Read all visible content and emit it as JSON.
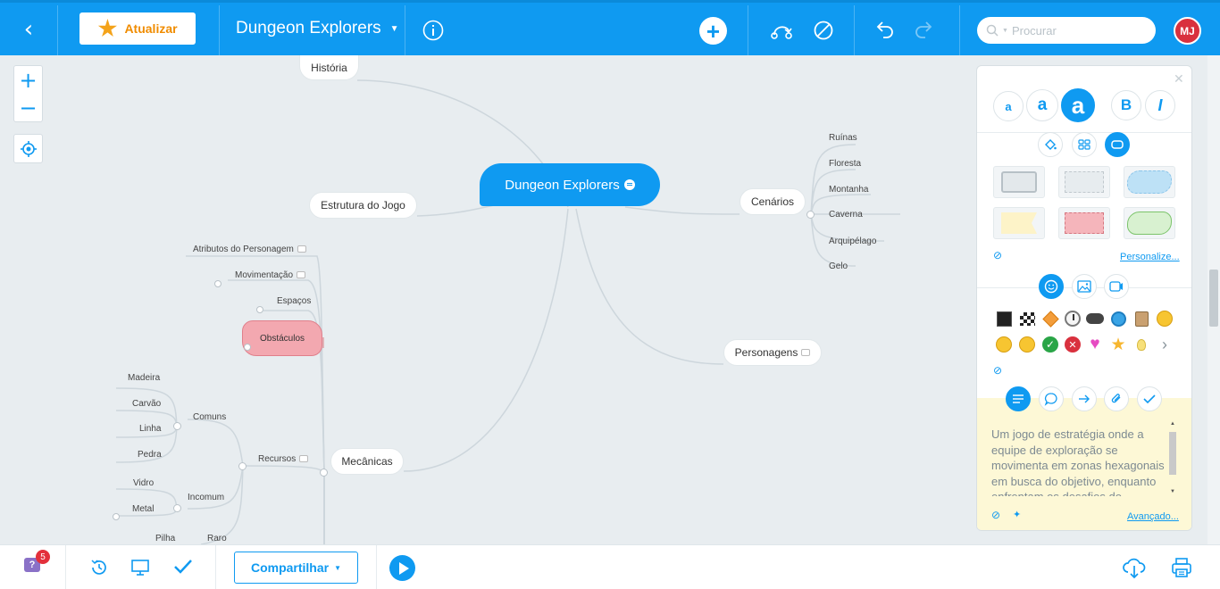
{
  "app": {
    "update_label": "Atualizar",
    "map_title": "Dungeon Explorers",
    "search_placeholder": "Procurar",
    "user_initials": "MJ",
    "notification_count": "5"
  },
  "mindmap": {
    "central": "Dungeon Explorers",
    "main_topics": [
      "História",
      "Estrutura do Jogo",
      "Cenários",
      "Personagens",
      "Mecânicas"
    ],
    "cenarios_children": [
      "Ruínas",
      "Floresta",
      "Montanha",
      "Caverna",
      "Arquipélago",
      "Gelo"
    ],
    "mecanicas_children": [
      "Atributos do Personagem",
      "Movimentação",
      "Espaços",
      "Obstáculos",
      "Recursos"
    ],
    "recursos_children": [
      "Comuns",
      "Incomum",
      "Raro"
    ],
    "comuns_children": [
      "Madeira",
      "Carvão",
      "Linha",
      "Pedra"
    ],
    "incomum_children": [
      "Vidro",
      "Metal"
    ],
    "raro_children": [
      "Pilha"
    ]
  },
  "panel": {
    "font_sizes": [
      "a",
      "a",
      "a"
    ],
    "bold": "B",
    "italic": "I",
    "customize_link": "Personalize...",
    "advanced_link": "Avançado...",
    "note_text": "Um jogo de estratégia onde a equipe de exploração se movimenta em zonas hexagonais em busca do objetivo, enquanto enfrentam os desafios do",
    "icons": [
      "black-square-icon",
      "checkered-flag-icon",
      "diamond-icon",
      "clock-icon",
      "gamepad-icon",
      "blue-clock-icon",
      "address-book-icon",
      "smiley-icon",
      "neutral-face-icon",
      "sad-face-icon",
      "green-check-icon",
      "red-x-icon",
      "heart-icon",
      "star-icon",
      "lightbulb-icon",
      "chevron-right-icon"
    ],
    "colors": {
      "accent": "#0f9af1",
      "note_bg": "#fdf8d6"
    }
  },
  "footer": {
    "share_label": "Compartilhar"
  }
}
